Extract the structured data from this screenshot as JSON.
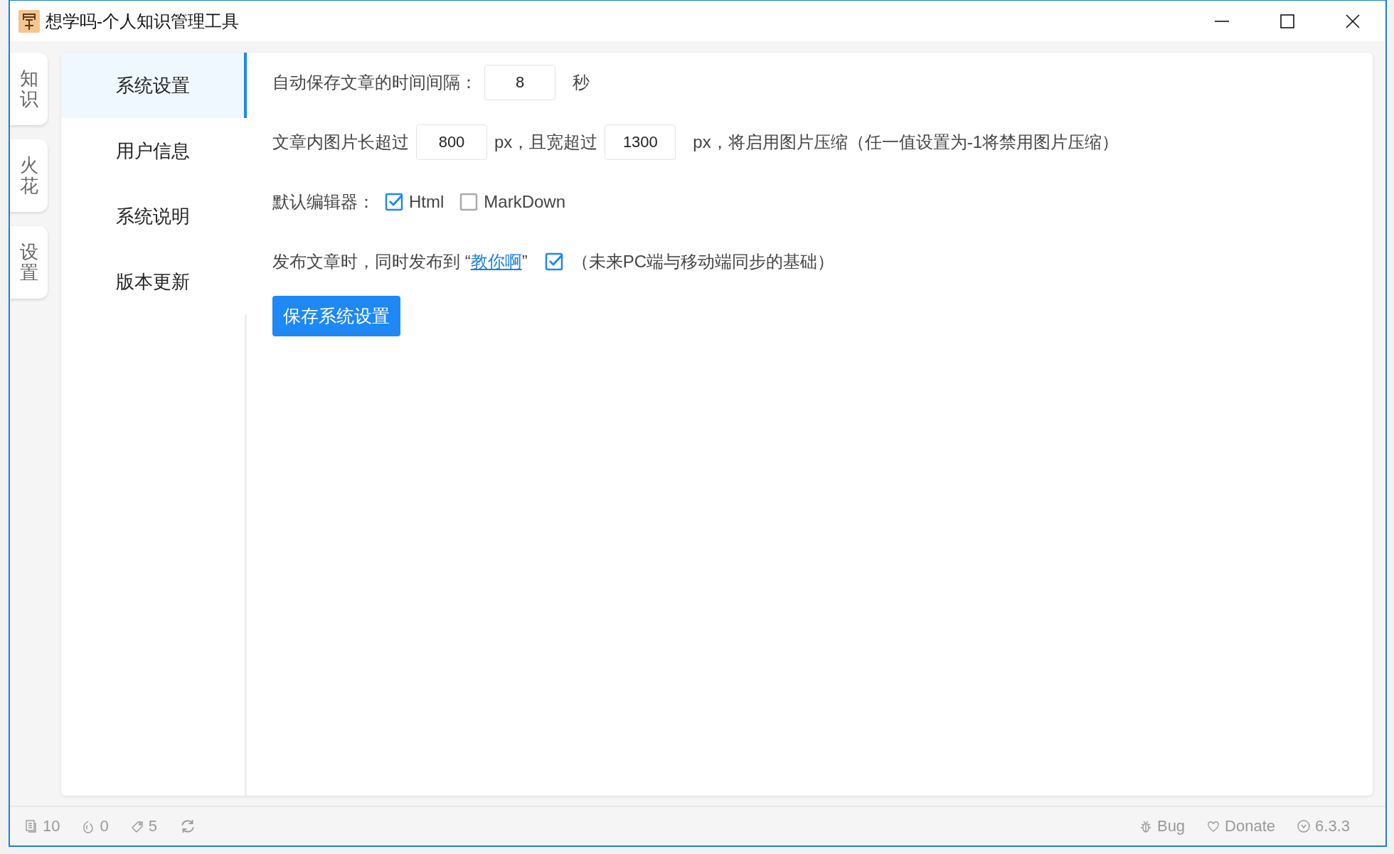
{
  "window": {
    "title": "想学吗-个人知识管理工具"
  },
  "side_tabs": [
    {
      "label": "知识"
    },
    {
      "label": "火花"
    },
    {
      "label": "设置"
    }
  ],
  "menu": [
    {
      "label": "系统设置",
      "selected": true
    },
    {
      "label": "用户信息",
      "selected": false
    },
    {
      "label": "系统说明",
      "selected": false
    },
    {
      "label": "版本更新",
      "selected": false
    }
  ],
  "settings": {
    "autosave": {
      "label": "自动保存文章的时间间隔：",
      "value": "8",
      "unit": "秒"
    },
    "image": {
      "label_1": "文章内图片长超过",
      "value_1": "800",
      "label_2": "px，且宽超过",
      "value_2": "1300",
      "label_3": "px，将启用图片压缩（任一值设置为-1将禁用图片压缩）"
    },
    "editor": {
      "label": "默认编辑器：",
      "options": [
        {
          "label": "Html",
          "checked": true
        },
        {
          "label": "MarkDown",
          "checked": false
        }
      ]
    },
    "publish": {
      "text_before": "发布文章时，同时发布到 “",
      "link": "教你啊",
      "text_after": "”",
      "checked": true,
      "note": "（未来PC端与移动端同步的基础）"
    },
    "save_button": "保存系统设置"
  },
  "status_bar": {
    "left": [
      {
        "kind": "docs",
        "text": "10"
      },
      {
        "kind": "sparks",
        "text": "0"
      },
      {
        "kind": "tags",
        "text": "5"
      },
      {
        "kind": "sync"
      }
    ],
    "right": [
      {
        "kind": "bug",
        "text": "Bug"
      },
      {
        "kind": "donate",
        "text": "Donate"
      },
      {
        "kind": "version",
        "text": "6.3.3"
      }
    ]
  }
}
